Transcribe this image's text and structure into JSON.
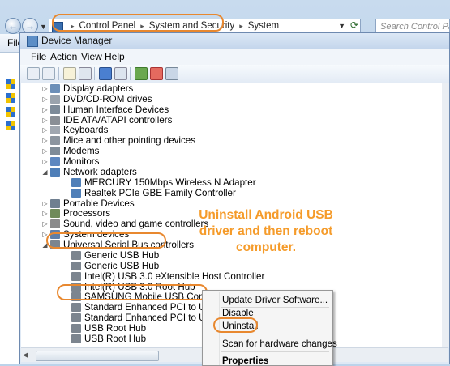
{
  "explorer": {
    "back_glyph": "←",
    "forward_glyph": "→",
    "breadcrumbs": [
      "Control Panel",
      "System and Security",
      "System"
    ],
    "separator": "▸",
    "search_placeholder": "Search Control Panel",
    "side_menu_label": "File"
  },
  "device_manager": {
    "title": "Device Manager",
    "menu": [
      "File",
      "Action",
      "View",
      "Help"
    ],
    "tree": [
      {
        "label": "Display adapters",
        "level": 0,
        "icon": "display-icon"
      },
      {
        "label": "DVD/CD-ROM drives",
        "level": 0,
        "icon": "dvd-icon"
      },
      {
        "label": "Human Interface Devices",
        "level": 0,
        "icon": "hid-icon"
      },
      {
        "label": "IDE ATA/ATAPI controllers",
        "level": 0,
        "icon": "ide-icon"
      },
      {
        "label": "Keyboards",
        "level": 0,
        "icon": "keyboard-icon"
      },
      {
        "label": "Mice and other pointing devices",
        "level": 0,
        "icon": "mouse-icon"
      },
      {
        "label": "Modems",
        "level": 0,
        "icon": "modem-icon"
      },
      {
        "label": "Monitors",
        "level": 0,
        "icon": "monitor-icon"
      },
      {
        "label": "Network adapters",
        "level": 0,
        "icon": "network-icon",
        "expanded": true
      },
      {
        "label": "MERCURY 150Mbps Wireless N Adapter",
        "level": 1,
        "icon": "network-icon"
      },
      {
        "label": "Realtek PCIe GBE Family Controller",
        "level": 1,
        "icon": "network-icon"
      },
      {
        "label": "Portable Devices",
        "level": 0,
        "icon": "portable-icon"
      },
      {
        "label": "Processors",
        "level": 0,
        "icon": "cpu-icon"
      },
      {
        "label": "Sound, video and game controllers",
        "level": 0,
        "icon": "sound-icon"
      },
      {
        "label": "System devices",
        "level": 0,
        "icon": "system-icon"
      },
      {
        "label": "Universal Serial Bus controllers",
        "level": 0,
        "icon": "usb-icon",
        "expanded": true
      },
      {
        "label": "Generic USB Hub",
        "level": 1,
        "icon": "usb-icon"
      },
      {
        "label": "Generic USB Hub",
        "level": 1,
        "icon": "usb-icon"
      },
      {
        "label": "Intel(R) USB 3.0 eXtensible Host Controller",
        "level": 1,
        "icon": "usb-icon"
      },
      {
        "label": "Intel(R) USB 3.0 Root Hub",
        "level": 1,
        "icon": "usb-icon"
      },
      {
        "label": "SAMSUNG Mobile USB Composite Device",
        "level": 1,
        "icon": "usb-icon"
      },
      {
        "label": "Standard Enhanced PCI to USB Host Controller",
        "level": 1,
        "icon": "usb-icon"
      },
      {
        "label": "Standard Enhanced PCI to USB Host Controller",
        "level": 1,
        "icon": "usb-icon"
      },
      {
        "label": "USB Root Hub",
        "level": 1,
        "icon": "usb-icon"
      },
      {
        "label": "USB Root Hub",
        "level": 1,
        "icon": "usb-icon"
      }
    ]
  },
  "context_menu": {
    "items": [
      "Update Driver Software...",
      "Disable",
      "Uninstall",
      "Scan for hardware changes",
      "Properties"
    ]
  },
  "annotation": {
    "text": "Uninstall Android USB driver and then reboot computer.",
    "color": "#f59b2a",
    "highlight_color": "#e8882f"
  }
}
